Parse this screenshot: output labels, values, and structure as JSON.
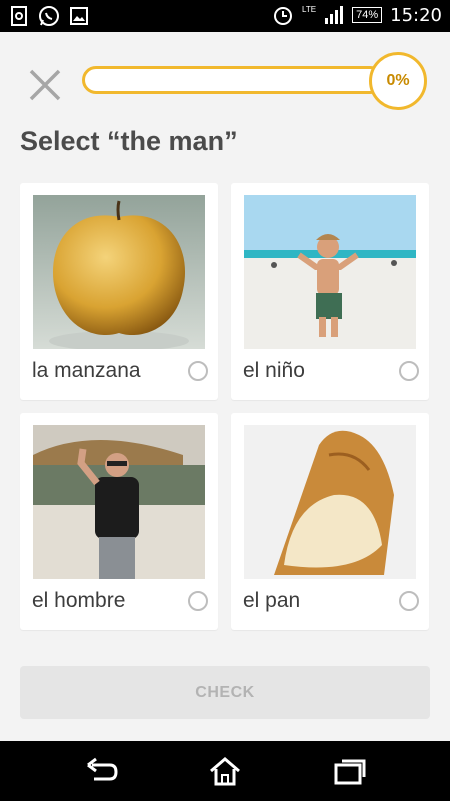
{
  "status_bar": {
    "time": "15:20",
    "battery": "74%",
    "network": "LTE",
    "left_icons": [
      "notification-icon",
      "whatsapp-icon",
      "gallery-icon"
    ],
    "right_icons": [
      "alarm-icon",
      "signal-icon",
      "battery-icon"
    ]
  },
  "header": {
    "close_icon": "close-icon",
    "progress_fraction": 0.0,
    "progress_label": "0%",
    "accent_color": "#f1b82d"
  },
  "prompt": "Select “the man”",
  "options": [
    {
      "label": "la manzana",
      "image": "apple"
    },
    {
      "label": "el niño",
      "image": "boy-on-beach"
    },
    {
      "label": "el hombre",
      "image": "man-waving"
    },
    {
      "label": "el pan",
      "image": "bread"
    }
  ],
  "check_button": {
    "label": "CHECK"
  },
  "nav_bar": {
    "icons": [
      "back-icon",
      "home-icon",
      "recent-apps-icon"
    ]
  }
}
